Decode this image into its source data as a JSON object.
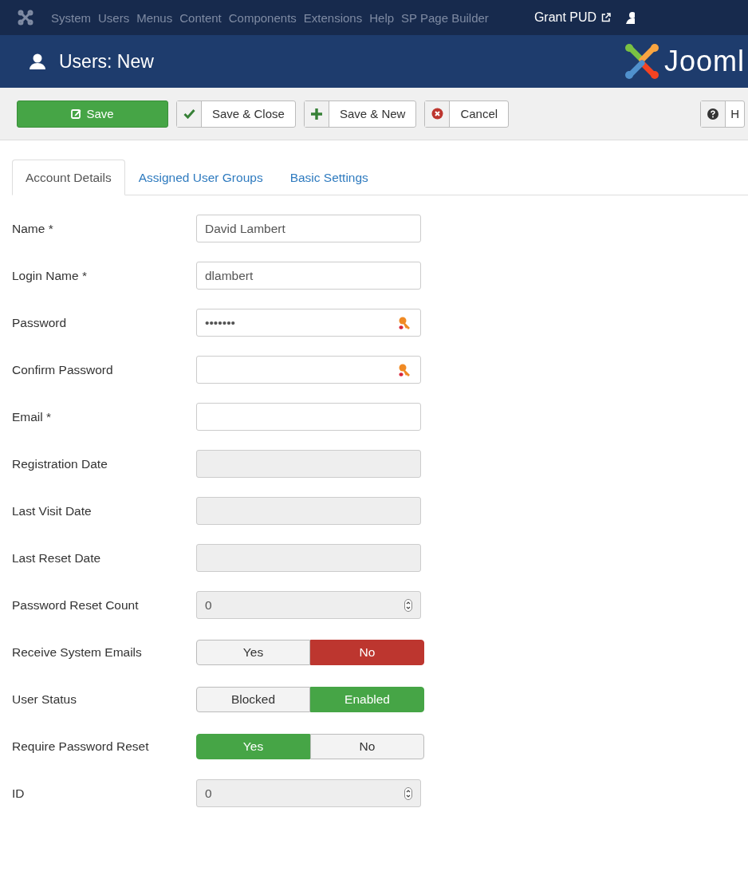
{
  "nav": {
    "items": [
      "System",
      "Users",
      "Menus",
      "Content",
      "Components",
      "Extensions",
      "Help",
      "SP Page Builder"
    ],
    "site": "Grant PUD"
  },
  "header": {
    "title": "Users: New",
    "logo": "Jooml"
  },
  "toolbar": [
    {
      "kind": "primary",
      "label": "Save"
    },
    {
      "kind": "check",
      "label": "Save & Close"
    },
    {
      "kind": "plus",
      "label": "Save & New"
    },
    {
      "kind": "cancel",
      "label": "Cancel"
    },
    {
      "kind": "help",
      "label": "H"
    }
  ],
  "tabs": [
    {
      "label": "Account Details",
      "selected": true
    },
    {
      "label": "Assigned User Groups",
      "selected": false
    },
    {
      "label": "Basic Settings",
      "selected": false
    }
  ],
  "fields": [
    {
      "kind": "text",
      "label": "Name *",
      "value": "David Lambert"
    },
    {
      "kind": "text",
      "label": "Login Name *",
      "value": "dlambert"
    },
    {
      "kind": "password",
      "label": "Password",
      "value": "•••••••"
    },
    {
      "kind": "password",
      "label": "Confirm Password"
    },
    {
      "kind": "text",
      "label": "Email *"
    },
    {
      "kind": "readonly",
      "label": "Registration Date"
    },
    {
      "kind": "readonly",
      "label": "Last Visit Date"
    },
    {
      "kind": "readonly",
      "label": "Last Reset Date"
    },
    {
      "kind": "number",
      "label": "Password Reset Count",
      "value": "0"
    },
    {
      "kind": "toggle",
      "label": "Receive System Emails",
      "options": [
        {
          "label": "Yes",
          "selected": false
        },
        {
          "label": "No",
          "selected": true,
          "color": "#bd362f"
        }
      ]
    },
    {
      "kind": "toggle",
      "label": "User Status",
      "options": [
        {
          "label": "Blocked",
          "selected": false
        },
        {
          "label": "Enabled",
          "selected": true,
          "color": "#46a546"
        }
      ]
    },
    {
      "kind": "toggle",
      "label": "Require Password Reset",
      "options": [
        {
          "label": "Yes",
          "selected": true,
          "color": "#46a546"
        },
        {
          "label": "No",
          "selected": false
        }
      ]
    },
    {
      "kind": "number",
      "label": "ID",
      "value": "0"
    }
  ]
}
